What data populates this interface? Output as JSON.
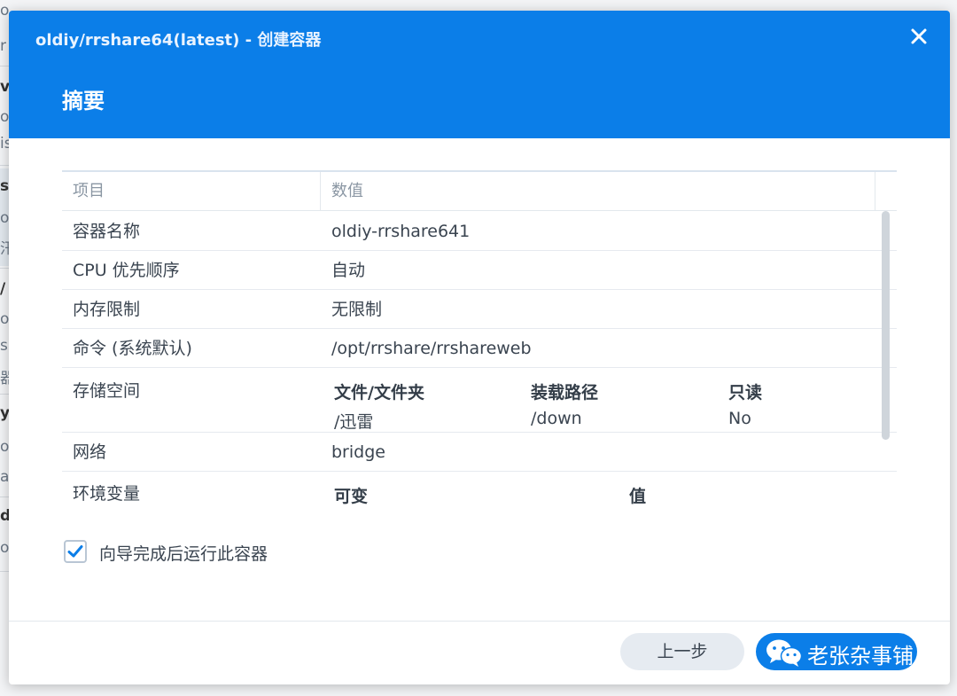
{
  "background": {
    "fragments": [
      "o",
      "r",
      "v",
      "o",
      "is",
      "sl",
      "o",
      "汛",
      "/",
      "o",
      "s",
      "器",
      "y",
      "o",
      "a",
      "d",
      "o"
    ]
  },
  "dialog": {
    "title": "oldiy/rrshare64(latest) - 创建容器",
    "step_title": "摘要",
    "close_symbol": "×"
  },
  "table": {
    "headers": [
      "项目",
      "数值"
    ],
    "rows": [
      {
        "item": "容器名称",
        "value": "oldiy-rrshare641"
      },
      {
        "item": "CPU 优先顺序",
        "value": "自动"
      },
      {
        "item": "内存限制",
        "value": "无限制"
      },
      {
        "item": "命令 (系统默认)",
        "value": "/opt/rrshare/rrshareweb"
      }
    ],
    "storage": {
      "item": "存储空间",
      "headers": [
        "文件/文件夹",
        "装载路径",
        "只读"
      ],
      "values": [
        "/迅雷",
        "/down",
        "No"
      ]
    },
    "network": {
      "item": "网络",
      "value": "bridge"
    },
    "env": {
      "item": "环境变量",
      "headers": [
        "可变",
        "值"
      ]
    }
  },
  "checkbox": {
    "label": "向导完成后运行此容器",
    "checked": true
  },
  "footer": {
    "prev_label": "上一步",
    "watermark": "老张杂事铺"
  },
  "colors": {
    "accent": "#0b7ee8",
    "header_text": "#e9f3ff"
  }
}
